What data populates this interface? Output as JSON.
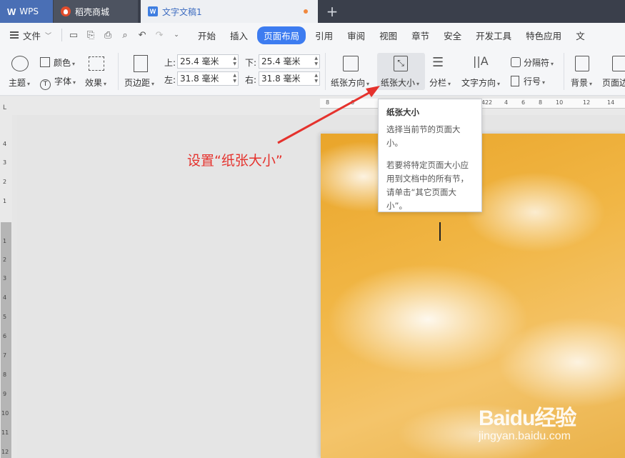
{
  "tabs": {
    "wps": "WPS",
    "store": "稻壳商城",
    "doc": "文字文稿1",
    "add": "+"
  },
  "menubar": {
    "file": "文件",
    "items": [
      "开始",
      "插入",
      "页面布局",
      "引用",
      "审阅",
      "视图",
      "章节",
      "安全",
      "开发工具",
      "特色应用",
      "文"
    ],
    "active_index": 2
  },
  "ribbon": {
    "color": "颜色",
    "theme": "主题",
    "font": "字体",
    "effect": "效果",
    "margin": "页边距",
    "top_label": "上:",
    "top_value": "25.4 毫米",
    "bottom_label": "下:",
    "bottom_value": "25.4 毫米",
    "left_label": "左:",
    "left_value": "31.8 毫米",
    "right_label": "右:",
    "right_value": "31.8 毫米",
    "orientation": "纸张方向",
    "size": "纸张大小",
    "columns": "分栏",
    "text_direction": "文字方向",
    "separator": "分隔符",
    "line_number": "行号",
    "background": "背景",
    "page_border": "页面边"
  },
  "ruler": {
    "top_numbers": [
      "8",
      "6",
      "4",
      "2",
      "2",
      "4",
      "6",
      "8",
      "10",
      "12",
      "14"
    ],
    "left_numbers": [
      "4",
      "3",
      "2",
      "1",
      "1",
      "2",
      "3",
      "4",
      "5",
      "6",
      "7",
      "8",
      "9",
      "10",
      "11",
      "12"
    ],
    "corner": "L"
  },
  "tooltip": {
    "title": "纸张大小",
    "line1": "选择当前节的页面大小。",
    "line2": "若要将特定页面大小应用到文档中的所有节，请单击“其它页面大小”。"
  },
  "annotation": "设置“纸张大小”",
  "watermark": {
    "logo": "Baidu经验",
    "url": "jingyan.baidu.com"
  },
  "colors": {
    "accent": "#3d7cf0",
    "annotation_red": "#e5322d",
    "tabbar": "#3a3f4b"
  }
}
